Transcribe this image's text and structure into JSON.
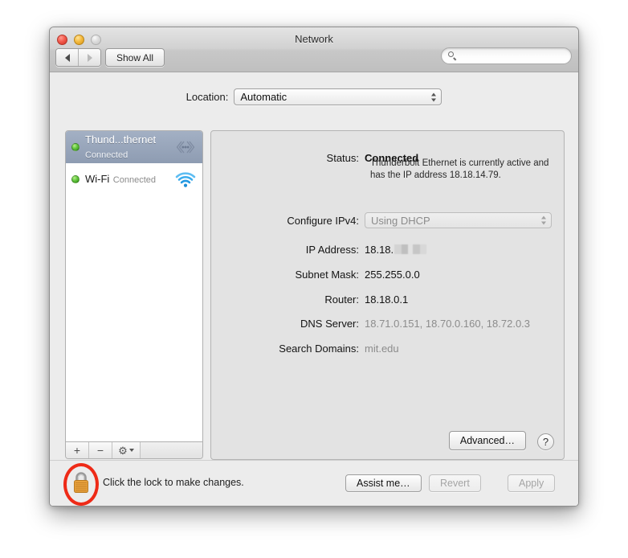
{
  "window": {
    "title": "Network",
    "traffic_lights": [
      "close-red",
      "minimize-yellow",
      "zoom-disabled-gray"
    ]
  },
  "toolbar": {
    "back_icon": "triangle-left-icon",
    "forward_icon": "triangle-right-icon",
    "show_all_label": "Show All",
    "search": {
      "icon": "search-icon",
      "value": "",
      "placeholder": ""
    }
  },
  "location": {
    "label": "Location:",
    "value": "Automatic",
    "stepper_icon": "stepper-updown-icon"
  },
  "sidebar": {
    "interfaces": [
      {
        "name": "Thund...thernet",
        "status": "Connected",
        "icon": "thunderbolt-icon",
        "status_dot": "green-dot",
        "selected": true
      },
      {
        "name": "Wi-Fi",
        "status": "Connected",
        "icon": "wifi-icon",
        "status_dot": "green-dot",
        "selected": false
      }
    ],
    "footer": {
      "add_label": "+",
      "remove_label": "−",
      "gear_icon": "gear-icon",
      "gear_caret_icon": "chevron-down-icon"
    }
  },
  "detail": {
    "status_label": "Status:",
    "status_value": "Connected",
    "status_description": "Thunderbolt Ethernet is currently active and has the IP address 18.18.14.79.",
    "configure_ipv4_label": "Configure IPv4:",
    "configure_ipv4_value": "Using DHCP",
    "ip_address_label": "IP Address:",
    "ip_address_value": "18.18.",
    "ip_address_redacted": true,
    "subnet_mask_label": "Subnet Mask:",
    "subnet_mask_value": "255.255.0.0",
    "router_label": "Router:",
    "router_value": "18.18.0.1",
    "dns_server_label": "DNS Server:",
    "dns_server_value": "18.71.0.151, 18.70.0.160, 18.72.0.3",
    "search_domains_label": "Search Domains:",
    "search_domains_value": "mit.edu",
    "advanced_label": "Advanced…",
    "help_label": "?"
  },
  "bottom": {
    "lock_icon": "lock-closed-icon",
    "lock_message": "Click the lock to make changes.",
    "assist_label": "Assist me…",
    "revert_label": "Revert",
    "apply_label": "Apply",
    "revert_disabled": true,
    "apply_disabled": true
  },
  "annotation": {
    "type": "ellipse-highlight",
    "target": "lock-icon",
    "color": "#ee2a17"
  }
}
